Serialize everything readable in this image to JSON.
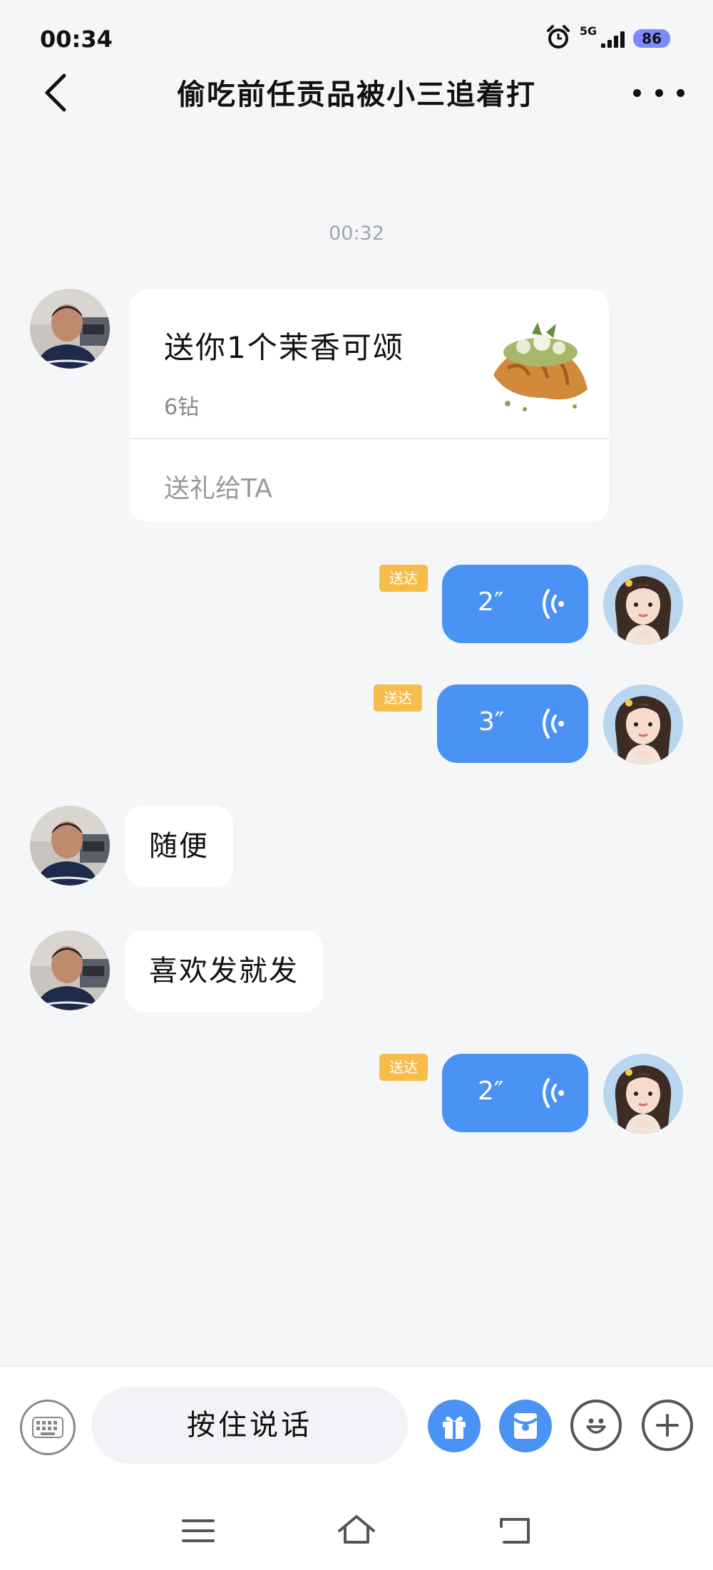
{
  "status_bar": {
    "time": "00:34",
    "network": "5G",
    "battery": "86"
  },
  "header": {
    "title": "偷吃前任贡品被小三追着打"
  },
  "messages": {
    "timestamp": "00:32",
    "gift": {
      "title": "送你1个茉香可颂",
      "price": "6钻",
      "link": "送礼给TA"
    },
    "voice_1": {
      "duration": "2″",
      "status": "送达"
    },
    "voice_2": {
      "duration": "3″",
      "status": "送达"
    },
    "text_1": "随便",
    "text_2": "喜欢发就发",
    "voice_3": {
      "duration": "2″",
      "status": "送达"
    }
  },
  "input_bar": {
    "hold_to_talk": "按住说话"
  },
  "colors": {
    "accent": "#4a92f4",
    "delivered_badge": "#f6bd4a",
    "background": "#f5f6f8"
  },
  "icons": [
    "keyboard-icon",
    "gift-icon",
    "red-packet-icon",
    "emoji-icon",
    "plus-icon",
    "menu-icon",
    "home-icon",
    "back-nav-icon"
  ]
}
